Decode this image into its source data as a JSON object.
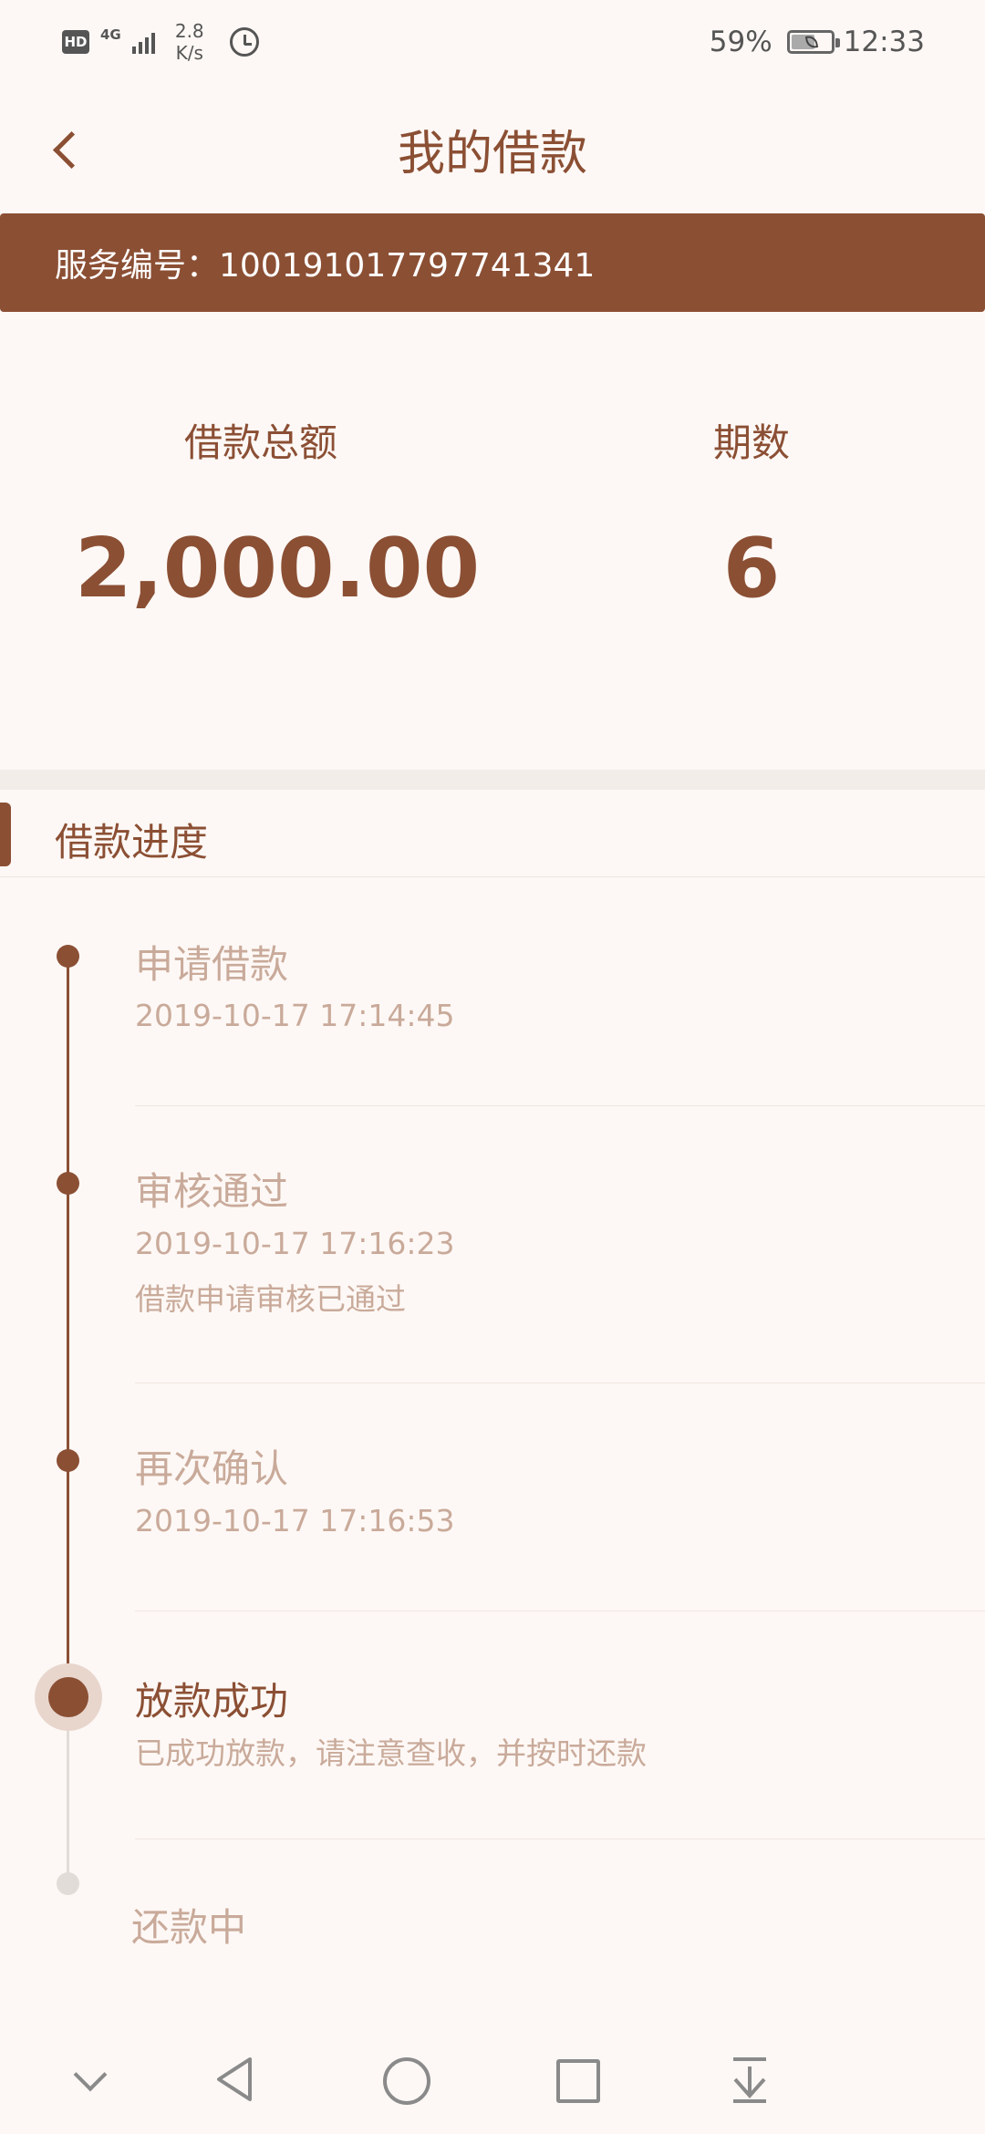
{
  "status_bar": {
    "hd": "HD",
    "network": "4G",
    "speed_value": "2.8",
    "speed_unit": "K/s",
    "battery_percent": "59%",
    "battery_level": 0.59,
    "time": "12:33"
  },
  "nav": {
    "title": "我的借款"
  },
  "service": {
    "label": "服务编号：100191017797741341"
  },
  "summary": {
    "amount_label": "借款总额",
    "amount_value": "2,000.00",
    "periods_label": "期数",
    "periods_value": "6"
  },
  "progress": {
    "title": "借款进度",
    "steps": [
      {
        "title": "申请借款",
        "time": "2019-10-17 17:14:45",
        "note": "",
        "status": "done"
      },
      {
        "title": "审核通过",
        "time": "2019-10-17 17:16:23",
        "note": "借款申请审核已通过",
        "status": "done"
      },
      {
        "title": "再次确认",
        "time": "2019-10-17 17:16:53",
        "note": "",
        "status": "done"
      },
      {
        "title": "放款成功",
        "time": "",
        "note": "已成功放款，请注意查收，并按时还款",
        "status": "current"
      },
      {
        "title": "还款中",
        "time": "",
        "note": "",
        "status": "pending"
      }
    ]
  },
  "colors": {
    "primary": "#8b4f34",
    "background": "#fdf8f5",
    "muted_text": "#c9aa9a"
  },
  "icons": {
    "back": "chevron-left-icon",
    "sys_collapse": "chevron-down-icon",
    "sys_back": "triangle-back-icon",
    "sys_home": "circle-home-icon",
    "sys_recent": "square-recent-icon",
    "sys_download": "download-arrow-icon"
  }
}
